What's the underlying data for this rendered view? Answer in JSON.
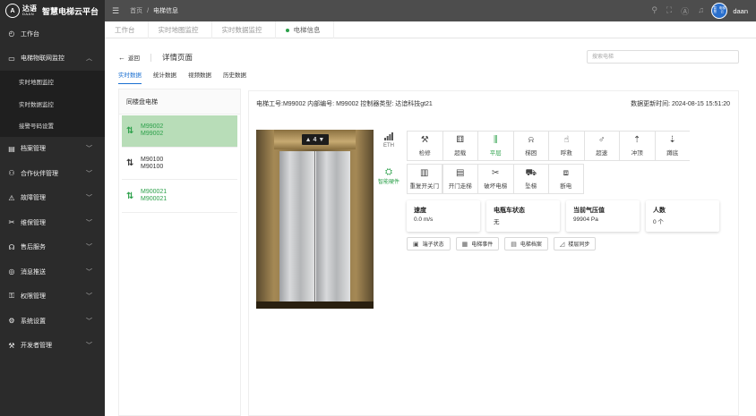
{
  "brand": {
    "logo_cn": "达语",
    "logo_en": "DAAN",
    "title": "智慧电梯云平台"
  },
  "sidebar": {
    "items": [
      {
        "label": "工作台",
        "icon": "dashboard-icon",
        "glyph": "◴",
        "has_children": false
      },
      {
        "label": "电梯物联网监控",
        "icon": "monitor-icon",
        "glyph": "▭",
        "has_children": true,
        "expanded": true,
        "children": [
          {
            "label": "实时地图监控"
          },
          {
            "label": "实时数据监控"
          },
          {
            "label": "接警号码设置"
          }
        ]
      },
      {
        "label": "档案管理",
        "icon": "archive-icon",
        "glyph": "▤",
        "has_children": true
      },
      {
        "label": "合作伙伴管理",
        "icon": "partner-icon",
        "glyph": "⚇",
        "has_children": true
      },
      {
        "label": "故障管理",
        "icon": "fault-icon",
        "glyph": "⚠",
        "has_children": true
      },
      {
        "label": "维保管理",
        "icon": "maintenance-icon",
        "glyph": "✂",
        "has_children": true
      },
      {
        "label": "售后服务",
        "icon": "service-icon",
        "glyph": "☊",
        "has_children": true
      },
      {
        "label": "消息推送",
        "icon": "message-icon",
        "glyph": "◎",
        "has_children": true
      },
      {
        "label": "权限管理",
        "icon": "permission-icon",
        "glyph": "⚿",
        "has_children": true
      },
      {
        "label": "系统设置",
        "icon": "settings-icon",
        "glyph": "⚙",
        "has_children": true
      },
      {
        "label": "开发者管理",
        "icon": "developer-icon",
        "glyph": "⚒",
        "has_children": true
      }
    ]
  },
  "topbar": {
    "breadcrumb": {
      "home": "首页",
      "separator": "/",
      "current": "电梯信息"
    },
    "icons": [
      "search-icon",
      "fullscreen-icon",
      "text-size-icon",
      "bell-icon"
    ],
    "avatar_text": "智慧\n电梯云",
    "username": "daan"
  },
  "tags": [
    {
      "label": "工作台",
      "active": false
    },
    {
      "label": "实时地图监控",
      "active": false
    },
    {
      "label": "实时数据监控",
      "active": false
    },
    {
      "label": "电梯信息",
      "active": true
    }
  ],
  "page": {
    "back_label": "返回",
    "title": "详情页面",
    "search_placeholder": "搜索电梯",
    "tabs": [
      {
        "label": "实时数据",
        "active": true
      },
      {
        "label": "统计数据",
        "active": false
      },
      {
        "label": "视频数据",
        "active": false
      },
      {
        "label": "历史数据",
        "active": false
      }
    ]
  },
  "left_panel": {
    "title": "同楼盘电梯",
    "elevators": [
      {
        "line1": "M99002",
        "line2": "M99002",
        "online": true,
        "selected": true
      },
      {
        "line1": "M90100",
        "line2": "M90100",
        "online": false,
        "selected": false
      },
      {
        "line1": "M900021",
        "line2": "M900021",
        "online": true,
        "selected": false
      }
    ]
  },
  "detail": {
    "info": "电梯工号:M99002 内部编号: M99002 控制器类型: 达谙科技gt21",
    "update_time_label": "数据更新时间: 2024-08-15 15:51:20",
    "floor_display": "▲ 4 ▼",
    "eth_label": "ETH",
    "smart_hw_label": "智能硬件",
    "status": [
      {
        "label": "检修",
        "icon": "repair-icon",
        "glyph": "⚒",
        "active": false
      },
      {
        "label": "超载",
        "icon": "overload-icon",
        "glyph": "⚅",
        "active": false
      },
      {
        "label": "平层",
        "icon": "level-icon",
        "glyph": "⫼",
        "active": true
      },
      {
        "label": "梯困",
        "icon": "trapped-icon",
        "glyph": "⍾",
        "active": false
      },
      {
        "label": "呼救",
        "icon": "help-call-icon",
        "glyph": "☝",
        "active": false
      },
      {
        "label": "超速",
        "icon": "overspeed-icon",
        "glyph": "♂",
        "active": false
      },
      {
        "label": "冲顶",
        "icon": "top-hit-icon",
        "glyph": "⇡",
        "active": false
      },
      {
        "label": "蹲底",
        "icon": "bottom-hit-icon",
        "glyph": "⇣",
        "active": false
      },
      {
        "label": "重复开关门",
        "icon": "door-repeat-icon",
        "glyph": "▥",
        "active": false
      },
      {
        "label": "开门走梯",
        "icon": "door-open-run-icon",
        "glyph": "▤",
        "active": false
      },
      {
        "label": "破坏电梯",
        "icon": "vandal-icon",
        "glyph": "✂",
        "active": false
      },
      {
        "label": "坠梯",
        "icon": "fall-icon",
        "glyph": "⛟",
        "active": false
      },
      {
        "label": "断电",
        "icon": "power-off-icon",
        "glyph": "⧈",
        "active": false
      }
    ],
    "readouts": [
      {
        "label": "速度",
        "value": "0.0 m/s"
      },
      {
        "label": "电瓶车状态",
        "value": "无"
      },
      {
        "label": "当前气压值",
        "value": "99904 Pa"
      },
      {
        "label": "人数",
        "value": "0 个"
      }
    ],
    "actions": [
      {
        "label": "端子状态",
        "icon": "terminal-icon",
        "glyph": "▣"
      },
      {
        "label": "电梯事件",
        "icon": "event-icon",
        "glyph": "▦"
      },
      {
        "label": "电梯档案",
        "icon": "archive-doc-icon",
        "glyph": "▤"
      },
      {
        "label": "楼层同步",
        "icon": "sync-icon",
        "glyph": "◿"
      }
    ]
  },
  "colors": {
    "accent": "#1a6fd1",
    "online": "#2ca04a",
    "selected_row": "#b8ddb8",
    "sidebar_bg": "#2b2b2b",
    "topbar_bg": "#4d4d4d"
  }
}
